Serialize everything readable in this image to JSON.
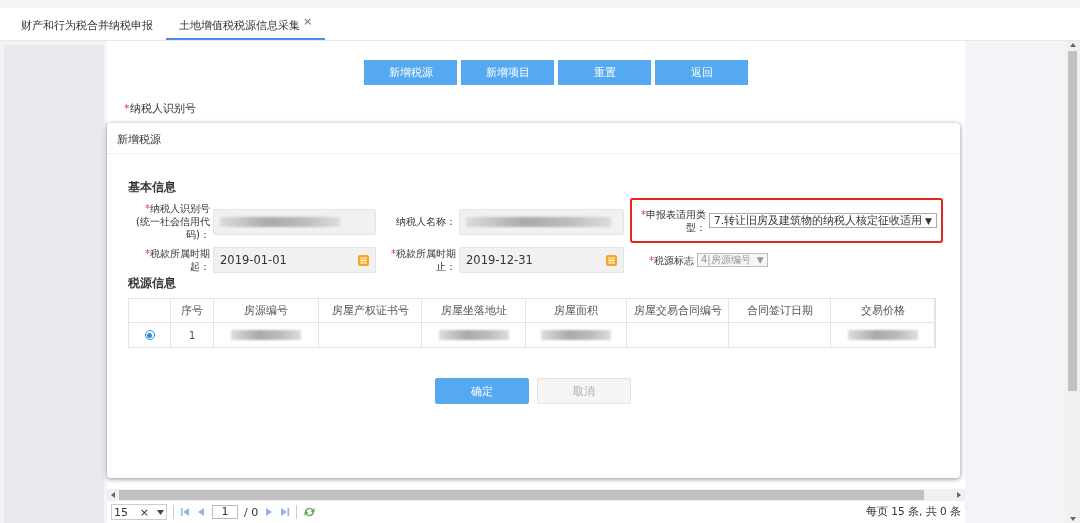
{
  "tabs": [
    {
      "label": "财产和行为税合并纳税申报",
      "selected": false
    },
    {
      "label": "土地增值税税源信息采集",
      "selected": true,
      "close_icon": "×"
    }
  ],
  "toolbar": [
    "新增税源",
    "新增项目",
    "重置",
    "返回"
  ],
  "background_label": {
    "label": "纳税人识别号",
    "mark": "*"
  },
  "dialog": {
    "title": "新增税源",
    "basic_section": "基本信息",
    "fields": [
      {
        "kind": "text",
        "mark": "*",
        "label": "纳税人识别号(统一社会信用代码)：",
        "redacted": true
      },
      {
        "kind": "text",
        "label": "纳税人名称：",
        "redacted": true
      },
      {
        "kind": "select",
        "mark": "*",
        "label": "申报表适用类型：",
        "value": "7.转让旧房及建筑物的纳税人核定征收适用",
        "caret": "▼",
        "highlighted": true
      },
      {
        "kind": "date",
        "mark": "*",
        "label": "税款所属时期起：",
        "value": "2019-01-01"
      },
      {
        "kind": "date",
        "mark": "*",
        "label": "税款所属时期止：",
        "value": "2019-12-31"
      },
      {
        "kind": "mini-select",
        "mark": "*",
        "label": "税源标志",
        "value": "4|房源编号",
        "caret": "▼",
        "disabled": true
      }
    ],
    "table_section": "税源信息",
    "table": {
      "columns": [
        "",
        "序号",
        "房源编号",
        "房屋产权证书号",
        "房屋坐落地址",
        "房屋面积",
        "房屋交易合同编号",
        "合同签订日期",
        "交易价格"
      ],
      "rows": [
        {
          "selected": true,
          "cells": [
            {
              "kind": "text",
              "text": "1"
            },
            {
              "kind": "redacted"
            },
            {
              "kind": "empty"
            },
            {
              "kind": "redacted"
            },
            {
              "kind": "redacted"
            },
            {
              "kind": "empty"
            },
            {
              "kind": "empty"
            },
            {
              "kind": "redacted"
            }
          ]
        }
      ]
    },
    "buttons": [
      {
        "label": "确定",
        "disabled": false
      },
      {
        "label": "取消",
        "disabled": true
      }
    ]
  },
  "pager": {
    "page_size": "15",
    "clear": "×",
    "page": "1",
    "total": "/ 0",
    "summary": "每页 15 条, 共 0 条"
  }
}
